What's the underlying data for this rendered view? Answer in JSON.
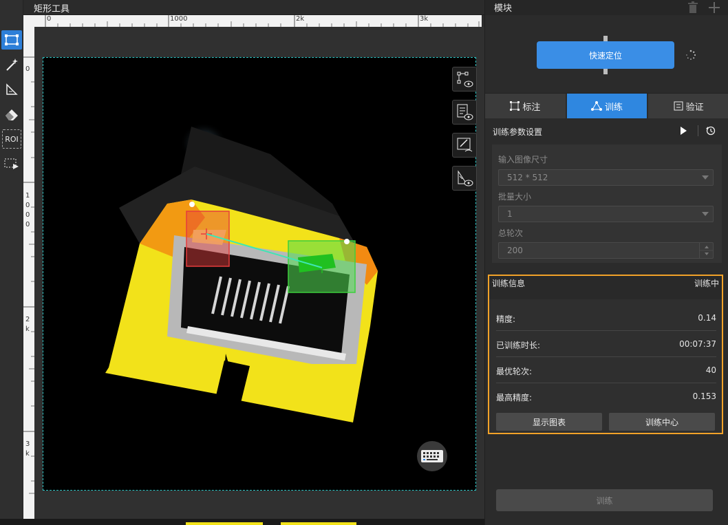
{
  "canvas": {
    "title": "矩形工具",
    "ruler_top_labels": [
      "0",
      "1000",
      "2k",
      "3k"
    ],
    "ruler_left_labels": [
      "0",
      "1",
      "0",
      "0",
      "0",
      "2",
      "k",
      "3",
      "k"
    ]
  },
  "tools": {
    "rect_icon": "rectangle-select-icon",
    "magic_icon": "magic-wand-icon",
    "polygon_icon": "polygon-icon",
    "eraser_icon": "eraser-icon",
    "roi_label": "ROI",
    "play_icon": "roi-play-icon"
  },
  "modules": {
    "title": "模块",
    "node_label": "快速定位"
  },
  "tabs": [
    {
      "label": "标注",
      "icon": "annotate-icon"
    },
    {
      "label": "训练",
      "icon": "train-icon"
    },
    {
      "label": "验证",
      "icon": "validate-icon"
    }
  ],
  "params": {
    "title": "训练参数设置",
    "image_size_label": "输入图像尺寸",
    "image_size_value": "512 * 512",
    "batch_label": "批量大小",
    "batch_value": "1",
    "epochs_label": "总轮次",
    "epochs_value": "200"
  },
  "info": {
    "title": "训练信息",
    "status": "训练中",
    "rows": [
      {
        "key": "精度:",
        "value": "0.14"
      },
      {
        "key": "已训练时长:",
        "value": "00:07:37"
      },
      {
        "key": "最优轮次:",
        "value": "40"
      },
      {
        "key": "最高精度:",
        "value": "0.153"
      }
    ],
    "chart_button": "显示图表",
    "center_button": "训练中心"
  },
  "train_button": "训练",
  "colors": {
    "accent": "#2f87e0",
    "highlight_border": "#f2a228",
    "roi_border": "#2ec4c4"
  }
}
